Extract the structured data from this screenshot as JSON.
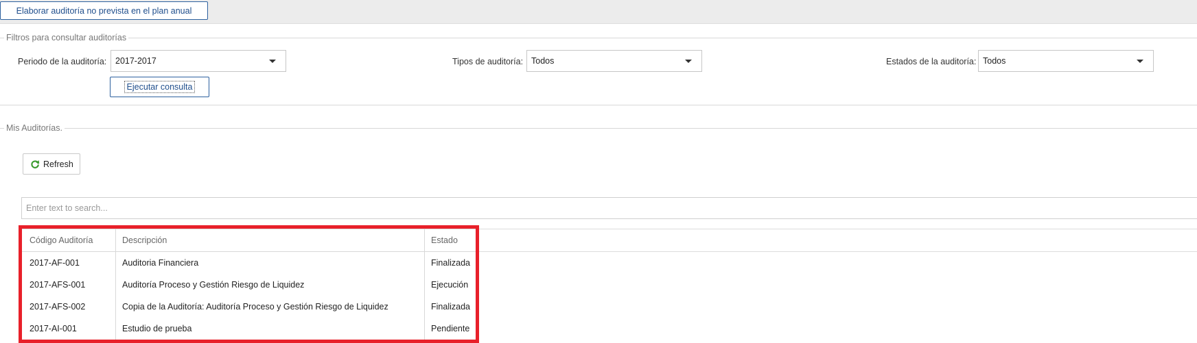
{
  "toolbar": {
    "plan_button_label": "Elaborar auditoría no prevista en el plan anual"
  },
  "filters": {
    "legend": "Filtros para consultar auditorías",
    "periodo": {
      "label": "Periodo de la auditoría:",
      "value": "2017-2017"
    },
    "tipos": {
      "label": "Tipos de auditoría:",
      "value": "Todos"
    },
    "estados": {
      "label": "Estados de la auditoría:",
      "value": "Todos"
    },
    "run_button_label": "Ejecutar consulta"
  },
  "audits": {
    "legend": "Mis Auditorías.",
    "refresh_label": "Refresh",
    "search_placeholder": "Enter text to search...",
    "columns": [
      "Código Auditoría",
      "Descripción",
      "Estado"
    ],
    "rows": [
      [
        "2017-AF-001",
        "Auditoria Financiera",
        "Finalizada"
      ],
      [
        "2017-AFS-001",
        "Auditoría Proceso y Gestión Riesgo de Liquidez",
        "Ejecución"
      ],
      [
        "2017-AFS-002",
        "Copia de la Auditoría: Auditoría Proceso y Gestión Riesgo de Liquidez",
        "Finalizada"
      ],
      [
        "2017-AI-001",
        "Estudio de prueba",
        "Pendiente"
      ]
    ]
  },
  "icons": {
    "refresh": "refresh-icon",
    "dropdown": "chevron-down-icon"
  },
  "colors": {
    "accent": "#2b5f9e",
    "highlight": "#e8202a",
    "refresh_icon": "#3a9a2e"
  }
}
